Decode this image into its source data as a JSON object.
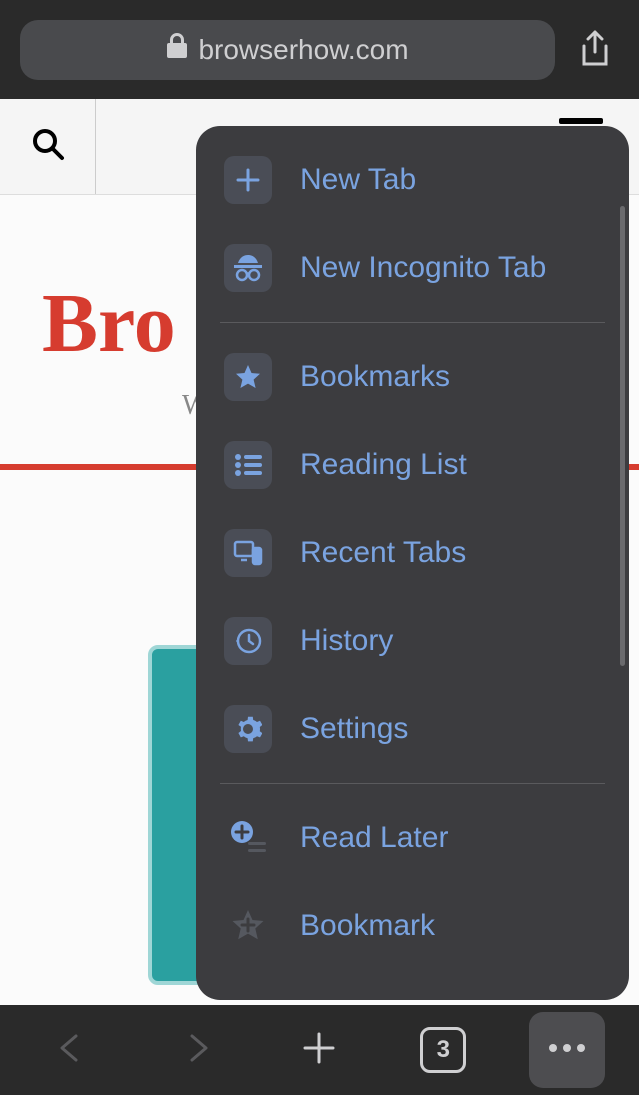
{
  "address_bar": {
    "domain": "browserhow.com"
  },
  "page": {
    "logo_text": "Bro",
    "subtitle_fragment": "W"
  },
  "menu": {
    "items": [
      {
        "label": "New Tab",
        "icon": "plus"
      },
      {
        "label": "New Incognito Tab",
        "icon": "incognito"
      },
      {
        "divider": true
      },
      {
        "label": "Bookmarks",
        "icon": "star"
      },
      {
        "label": "Reading List",
        "icon": "list"
      },
      {
        "label": "Recent Tabs",
        "icon": "devices"
      },
      {
        "label": "History",
        "icon": "history"
      },
      {
        "label": "Settings",
        "icon": "gear"
      },
      {
        "divider": true
      },
      {
        "label": "Read Later",
        "icon": "read-later"
      },
      {
        "label": "Bookmark",
        "icon": "star-plus"
      }
    ]
  },
  "bottom_bar": {
    "tab_count": "3"
  }
}
